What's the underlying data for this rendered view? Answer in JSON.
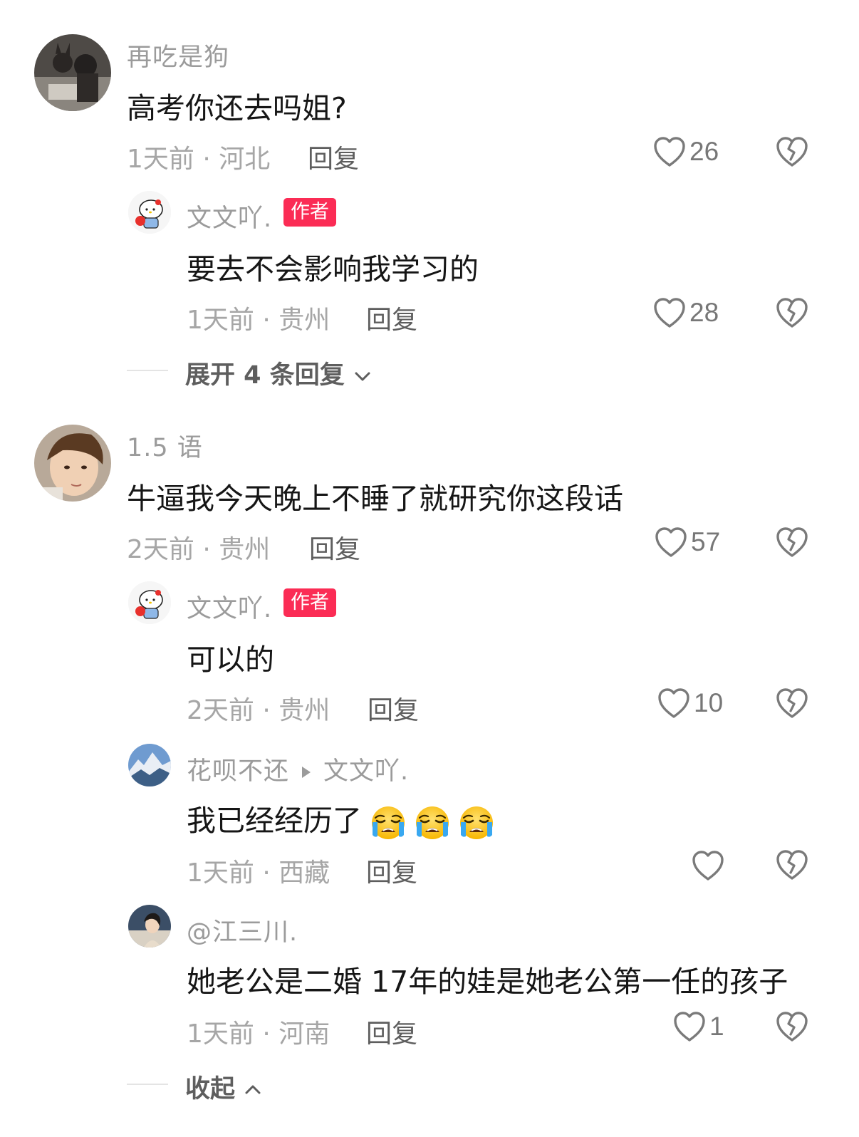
{
  "comments": [
    {
      "username": "再吃是狗",
      "content": "高考你还去吗姐?",
      "meta": "1天前 · 河北",
      "reply_label": "回复",
      "likes": "26",
      "replies": [
        {
          "username": "文文吖.",
          "badge": "作者",
          "content": "要去不会影响我学习的",
          "meta": "1天前 · 贵州",
          "reply_label": "回复",
          "likes": "28"
        }
      ],
      "expand_label": "展开 4 条回复"
    },
    {
      "username": "1.5 语",
      "content": "牛逼我今天晚上不睡了就研究你这段话",
      "meta": "2天前 · 贵州",
      "reply_label": "回复",
      "likes": "57",
      "replies": [
        {
          "username": "文文吖.",
          "badge": "作者",
          "content": "可以的",
          "meta": "2天前 · 贵州",
          "reply_label": "回复",
          "likes": "10"
        },
        {
          "username": "花呗不还",
          "reply_to": "文文吖.",
          "content": "我已经经历了",
          "meta": "1天前 · 西藏",
          "reply_label": "回复",
          "likes": ""
        },
        {
          "username": "@江三川.",
          "content": "她老公是二婚 17年的娃是她老公第一任的孩子",
          "meta": "1天前 · 河南",
          "reply_label": "回复",
          "likes": "1"
        }
      ],
      "collapse_label": "收起"
    }
  ],
  "icons": {
    "like": "heart-outline-icon",
    "dislike": "broken-heart-icon",
    "emoji": "loudly-crying-face-emoji"
  },
  "colors": {
    "badge": "#fb2c55",
    "username": "#9b9b9b",
    "meta": "#a6a6a6"
  }
}
